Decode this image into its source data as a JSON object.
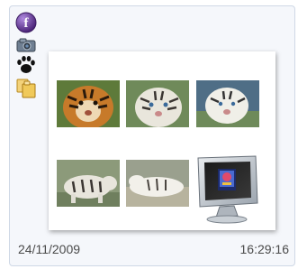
{
  "icons": {
    "facebook": "facebook-icon",
    "camera": "camera-icon",
    "paw": "paw-icon",
    "folders": "folders-icon"
  },
  "footer": {
    "date": "24/11/2009",
    "time": "16:29:16"
  },
  "colors": {
    "card_bg": "#f5f7fb",
    "card_border": "#cfd8e6",
    "facebook_purple": "#6a3d9a"
  }
}
